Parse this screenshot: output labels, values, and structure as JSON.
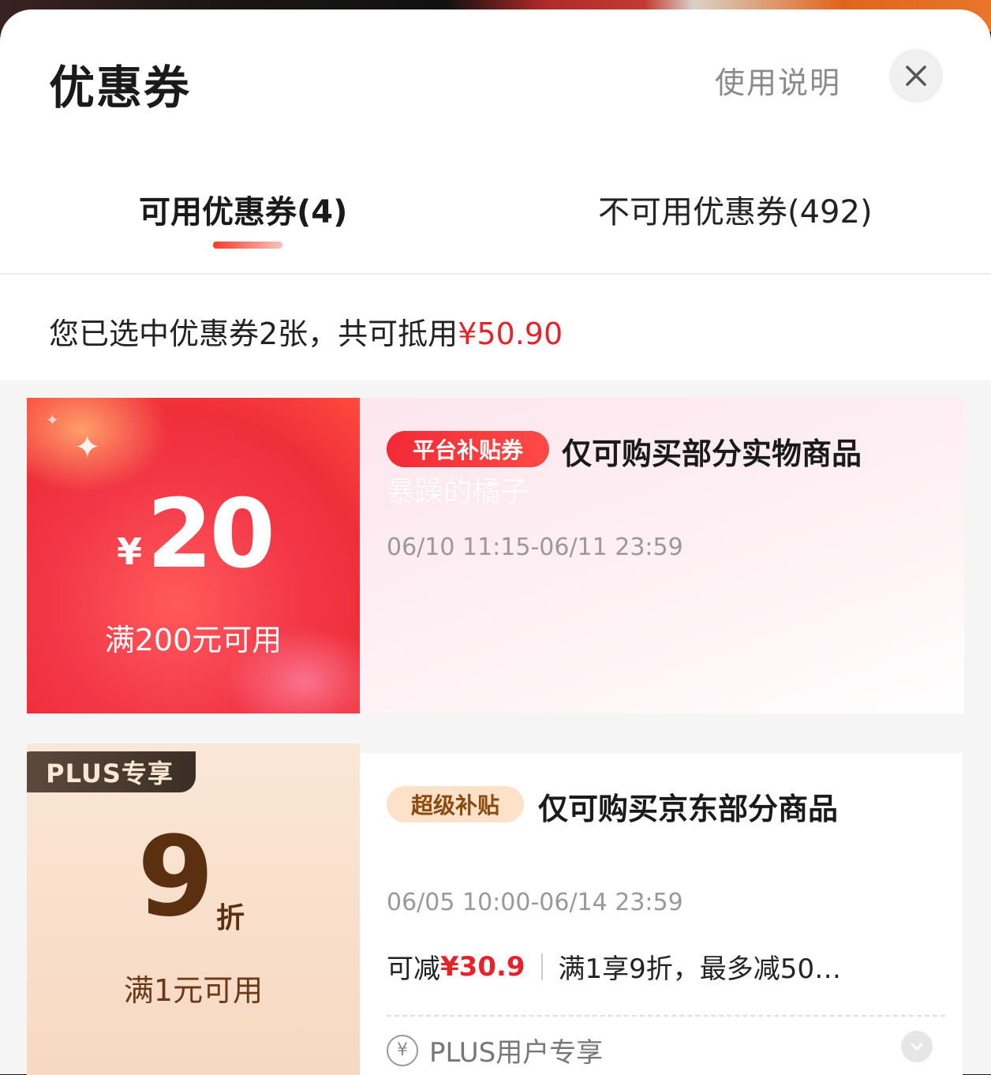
{
  "header": {
    "title": "优惠券",
    "help_label": "使用说明",
    "close_icon": "close-icon"
  },
  "tabs": [
    {
      "label": "可用优惠券(4)",
      "active": true
    },
    {
      "label": "不可用优惠券(492)",
      "active": false
    }
  ],
  "summary": {
    "text": "您已选中优惠券2张，共可抵用",
    "amount": "¥50.90"
  },
  "coupons": [
    {
      "currency": "¥",
      "amount": "20",
      "condition": "满200元可用",
      "badge": "平台补贴券",
      "title": "仅可购买部分实物商品",
      "watermark": "暴躁的橘子",
      "date_range": "06/10 11:15-06/11 23:59",
      "selected": true,
      "colors": {
        "left": "#f33748",
        "badge": "#f22a36"
      }
    },
    {
      "tag": "PLUS专享",
      "amount": "9",
      "unit": "折",
      "condition": "满1元可用",
      "badge": "超级补贴",
      "title": "仅可购买京东部分商品",
      "date_range": "06/05 10:00-06/14 23:59",
      "save_prefix": "可减",
      "save_amount": "¥30.9",
      "rule": "满1享9折，最多减50…",
      "note": "PLUS用户专享",
      "note_icon": "yen-circle-icon",
      "selected": true,
      "colors": {
        "left": "#f7d8c2",
        "text": "#5a3010"
      }
    }
  ]
}
